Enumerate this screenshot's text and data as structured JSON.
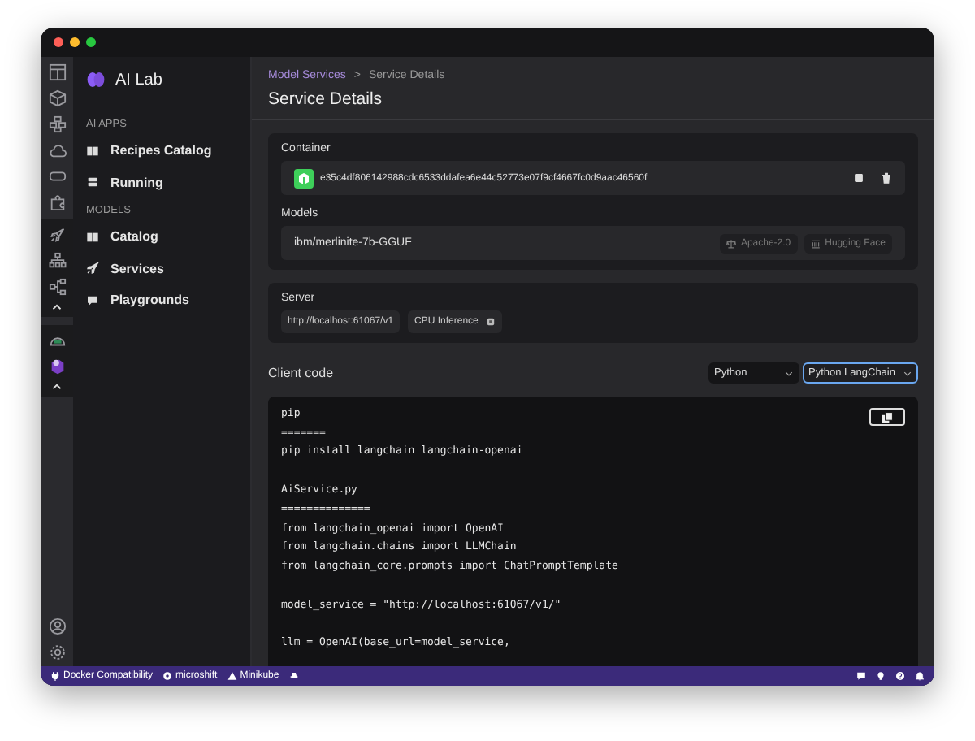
{
  "app": {
    "title": "AI Lab"
  },
  "nav_sections": [
    {
      "heading": "AI APPS",
      "items": [
        {
          "label": "Recipes Catalog",
          "kind": "book"
        },
        {
          "label": "Running",
          "kind": "server"
        }
      ]
    },
    {
      "heading": "MODELS",
      "items": [
        {
          "label": "Catalog",
          "kind": "book"
        },
        {
          "label": "Services",
          "kind": "rocket"
        },
        {
          "label": "Playgrounds",
          "kind": "chat"
        }
      ]
    }
  ],
  "breadcrumb": {
    "parent": "Model Services",
    "separator": ">",
    "current": "Service Details"
  },
  "page_title": "Service Details",
  "container": {
    "label": "Container",
    "id": "e35c4df806142988cdc6533ddafea6e44c52773e07f9cf4667fc0d9aac46560f"
  },
  "models": {
    "label": "Models",
    "name": "ibm/merlinite-7b-GGUF",
    "tags": [
      {
        "label": "Apache-2.0",
        "kind": "license"
      },
      {
        "label": "Hugging Face",
        "kind": "registry"
      }
    ]
  },
  "server": {
    "label": "Server",
    "url": "http://localhost:61067/v1",
    "inference": "CPU Inference"
  },
  "client_code": {
    "title": "Client code",
    "selects": [
      {
        "value": "Python",
        "focused": false
      },
      {
        "value": "Python LangChain",
        "focused": true
      }
    ],
    "blocks": [
      [
        "pip",
        "=======",
        "pip install langchain langchain-openai"
      ],
      [
        "AiService.py",
        "==============",
        "from langchain_openai import OpenAI",
        "from langchain.chains import LLMChain",
        "from langchain_core.prompts import ChatPromptTemplate"
      ],
      [
        "model_service = \"http://localhost:61067/v1/\""
      ],
      [
        "llm = OpenAI(base_url=model_service,"
      ]
    ]
  },
  "status_bar": {
    "items": [
      {
        "label": "Docker Compatibility",
        "kind": "plug"
      },
      {
        "label": "microshift",
        "kind": "dot"
      },
      {
        "label": "Minikube",
        "kind": "warning"
      }
    ]
  }
}
